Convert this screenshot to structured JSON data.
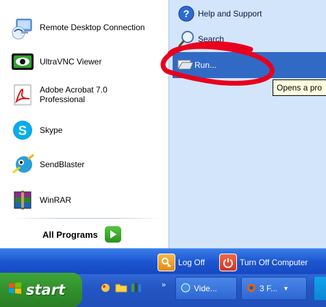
{
  "programs": [
    {
      "label": "Remote Desktop Connection",
      "icon": "remote-desktop-icon"
    },
    {
      "label": "UltraVNC Viewer",
      "icon": "ultravnc-icon"
    },
    {
      "label_line1": "Adobe Acrobat 7.0",
      "label_line2": "Professional",
      "icon": "acrobat-icon"
    },
    {
      "label": "Skype",
      "icon": "skype-icon"
    },
    {
      "label": "SendBlaster",
      "icon": "sendblaster-icon"
    },
    {
      "label": "WinRAR",
      "icon": "winrar-icon"
    }
  ],
  "all_programs": "All Programs",
  "places": {
    "help": "Help and Support",
    "search": "Search",
    "run": "Run...",
    "run_tooltip": "Opens a pro"
  },
  "bottom": {
    "logoff": "Log Off",
    "turnoff": "Turn Off Computer"
  },
  "taskbar": {
    "start": "start",
    "chevron": "»",
    "buttons": [
      "Vide...",
      "3 F..."
    ]
  },
  "colors": {
    "annotation": "#e8001c",
    "selected": "#316ac5",
    "start_green": "#3fa43a"
  }
}
